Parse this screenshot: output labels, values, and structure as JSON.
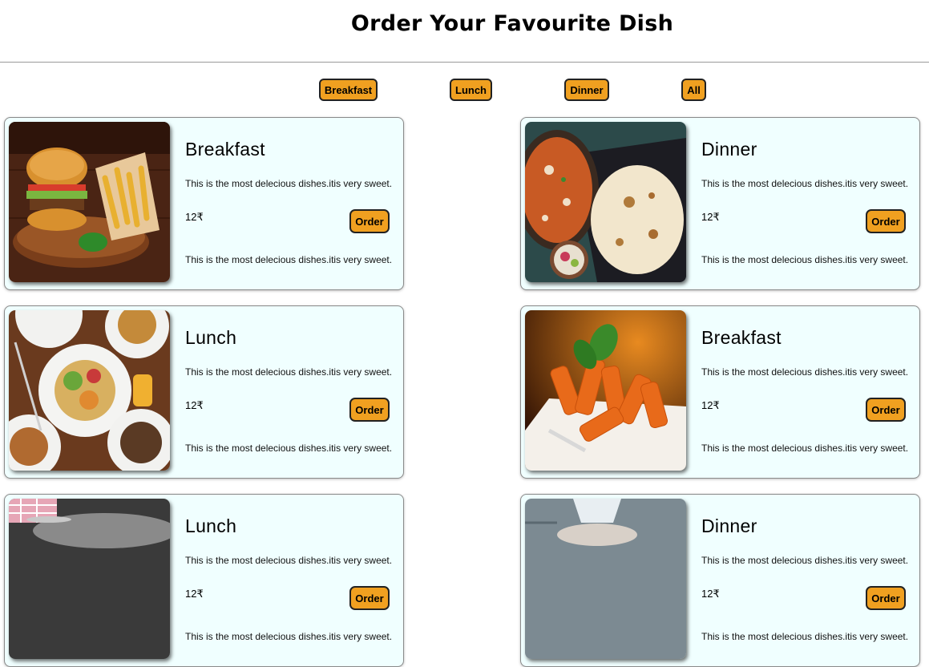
{
  "header": {
    "title": "Order Your Favourite Dish"
  },
  "filters": [
    "Breakfast",
    "Lunch",
    "Dinner",
    "All"
  ],
  "menu": [
    {
      "title": "Breakfast",
      "desc_top": "This is the most delecious dishes.itis very sweet.",
      "price": "12₹",
      "order_label": "Order",
      "desc_bottom": "This is the most delecious dishes.itis very sweet.",
      "image": "burger-fries-image"
    },
    {
      "title": "Dinner",
      "desc_top": "This is the most delecious dishes.itis very sweet.",
      "price": "12₹",
      "order_label": "Order",
      "desc_bottom": "This is the most delecious dishes.itis very sweet.",
      "image": "curry-naan-image"
    },
    {
      "title": "Lunch",
      "desc_top": "This is the most delecious dishes.itis very sweet.",
      "price": "12₹",
      "order_label": "Order",
      "desc_bottom": "This is the most delecious dishes.itis very sweet.",
      "image": "lunch-platter-image"
    },
    {
      "title": "Breakfast",
      "desc_top": "This is the most delecious dishes.itis very sweet.",
      "price": "12₹",
      "order_label": "Order",
      "desc_bottom": "This is the most delecious dishes.itis very sweet.",
      "image": "pasta-image"
    },
    {
      "title": "Lunch",
      "desc_top": "This is the most delecious dishes.itis very sweet.",
      "price": "12₹",
      "order_label": "Order",
      "desc_bottom": "This is the most delecious dishes.itis very sweet.",
      "image": "thali-image"
    },
    {
      "title": "Dinner",
      "desc_top": "This is the most delecious dishes.itis very sweet.",
      "price": "12₹",
      "order_label": "Order",
      "desc_bottom": "This is the most delecious dishes.itis very sweet.",
      "image": "bowl-image"
    }
  ],
  "colors": {
    "accent": "#f0a020",
    "card_bg": "#f0ffff",
    "divider": "#9a9a9a"
  }
}
